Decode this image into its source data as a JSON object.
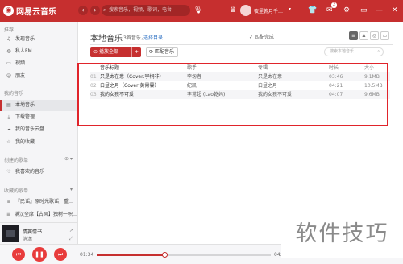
{
  "app": {
    "logo_text": "网易云音乐"
  },
  "topbar": {
    "search_placeholder": "搜索音乐，视频，歌词，电台",
    "username": "夜里俯月千…",
    "badge": "2"
  },
  "sidebar": {
    "recommend_title": "推荐",
    "recommend_items": [
      {
        "label": "发现音乐",
        "icon": "music-note-icon"
      },
      {
        "label": "私人FM",
        "icon": "radio-icon"
      },
      {
        "label": "视频",
        "icon": "video-icon"
      },
      {
        "label": "朋友",
        "icon": "friends-icon"
      }
    ],
    "mymusic_title": "我的音乐",
    "mymusic_items": [
      {
        "label": "本地音乐",
        "icon": "local-music-icon",
        "active": true
      },
      {
        "label": "下载管理",
        "icon": "download-icon"
      },
      {
        "label": "我的音乐云盘",
        "icon": "cloud-icon"
      },
      {
        "label": "我的收藏",
        "icon": "star-icon"
      }
    ],
    "created_title": "创建的歌单",
    "created_items": [
      {
        "label": "我喜欢的音乐",
        "icon": "heart-icon"
      }
    ],
    "fav_title": "收藏的歌单",
    "fav_items": [
      {
        "label": "『民谣』原时光歌谣，重…",
        "icon": "playlist-icon"
      },
      {
        "label": "满汉全席【古风】独树一帜…",
        "icon": "playlist-icon"
      }
    ]
  },
  "nowplaying": {
    "title": "情窦情书",
    "artist": "洛潇"
  },
  "player": {
    "current_time": "01:34",
    "total_time": "04:0",
    "progress": 0.39
  },
  "main": {
    "title": "本地音乐",
    "song_count": "3首音乐，",
    "select_dir": "选择目录",
    "match_done": "✓ 匹配完成",
    "play_all": "播放全部",
    "plus": "+",
    "match_music": "匹配音乐",
    "search_placeholder": "搜索本地音乐",
    "table": {
      "headers": [
        "音乐标题",
        "歌手",
        "专辑",
        "时长",
        "大小"
      ],
      "rows": [
        {
          "idx": "01",
          "title": "只是太在意（Cover:宇桐非）",
          "artist": "李匆者",
          "album": "只是太在意",
          "duration": "03:46",
          "size": "9.1MB"
        },
        {
          "idx": "02",
          "title": "白昼之月（Cover:黄霄雲）",
          "artist": "纪凯",
          "album": "白昼之月",
          "duration": "04:21",
          "size": "10.5MB"
        },
        {
          "idx": "03",
          "title": "我的女孩不可爱",
          "artist": "李常超 (Lao乾妈)",
          "album": "我的女孩不可爱",
          "duration": "04:07",
          "size": "9.6MB"
        }
      ]
    }
  },
  "watermark": "软件技巧",
  "colors": {
    "brand": "#c62f2f",
    "highlight_box": "#e0242b"
  }
}
